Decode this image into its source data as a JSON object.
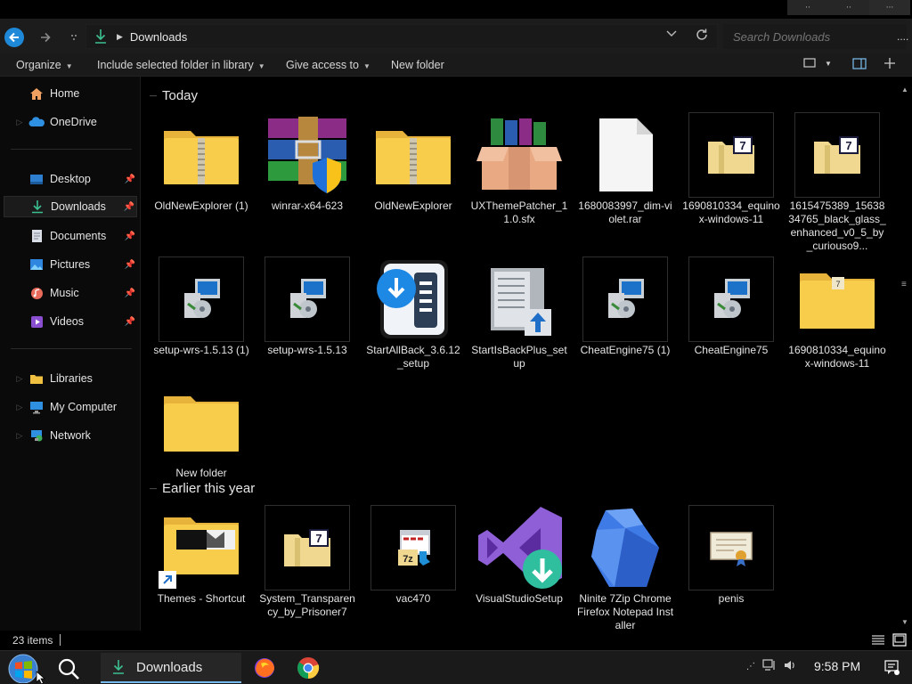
{
  "window": {
    "minimize_glyph": "⋅⋅",
    "maximize_glyph": "⋅⋅",
    "close_glyph": "⋅⋅⋅"
  },
  "address": {
    "location": "Downloads",
    "search_placeholder": "Search Downloads",
    "more_glyph": "...."
  },
  "commands": {
    "organize": "Organize",
    "include_library": "Include selected folder in library",
    "give_access": "Give access to",
    "new_folder": "New folder"
  },
  "nav": {
    "home": "Home",
    "onedrive": "OneDrive",
    "desktop": "Desktop",
    "downloads": "Downloads",
    "documents": "Documents",
    "pictures": "Pictures",
    "music": "Music",
    "videos": "Videos",
    "libraries": "Libraries",
    "my_computer": "My Computer",
    "network": "Network"
  },
  "groups": {
    "today": "Today",
    "earlier": "Earlier this year"
  },
  "files_today": [
    {
      "name": "OldNewExplorer (1)",
      "icon": "zip-folder-icon"
    },
    {
      "name": "winrar-x64-623",
      "icon": "winrar-installer-icon"
    },
    {
      "name": "OldNewExplorer",
      "icon": "zip-folder-icon"
    },
    {
      "name": "UXThemePatcher_11.0.sfx",
      "icon": "sfx-archive-icon"
    },
    {
      "name": "1680083997_dim-violet.rar",
      "icon": "blank-file-icon"
    },
    {
      "name": "1690810334_equinox-windows-11",
      "icon": "7z-archive-icon"
    },
    {
      "name": "1615475389_1563834765_black_glass_enhanced_v0_5_by_curiouso9...",
      "icon": "7z-archive-icon"
    },
    {
      "name": "setup-wrs-1.5.13 (1)",
      "icon": "setup-installer-icon"
    },
    {
      "name": "setup-wrs-1.5.13",
      "icon": "setup-installer-icon"
    },
    {
      "name": "StartAllBack_3.6.12_setup",
      "icon": "startallback-icon"
    },
    {
      "name": "StartIsBackPlus_setup",
      "icon": "startisback-icon"
    },
    {
      "name": "CheatEngine75 (1)",
      "icon": "setup-installer-icon"
    },
    {
      "name": "CheatEngine75",
      "icon": "setup-installer-icon"
    },
    {
      "name": "1690810334_equinox-windows-11",
      "icon": "7z-folder-icon"
    },
    {
      "name": "New folder",
      "icon": "folder-icon"
    }
  ],
  "files_earlier": [
    {
      "name": "Themes - Shortcut",
      "icon": "shortcut-folder-icon"
    },
    {
      "name": "System_Transparency_by_Prisoner7",
      "icon": "7z-archive-icon"
    },
    {
      "name": "vac470",
      "icon": "7zip-installer-icon"
    },
    {
      "name": "VisualStudioSetup",
      "icon": "visual-studio-icon"
    },
    {
      "name": "Ninite 7Zip Chrome Firefox Notepad Installer",
      "icon": "ninite-icon"
    },
    {
      "name": "penis",
      "icon": "certificate-icon"
    }
  ],
  "status": {
    "item_count": "23 items"
  },
  "taskbar": {
    "explorer_label": "Downloads",
    "time": "9:58 PM"
  },
  "colors": {
    "accent": "#1e88d9",
    "folder_yellow": "#f8cd4c",
    "download_green": "#3cbf8f"
  }
}
